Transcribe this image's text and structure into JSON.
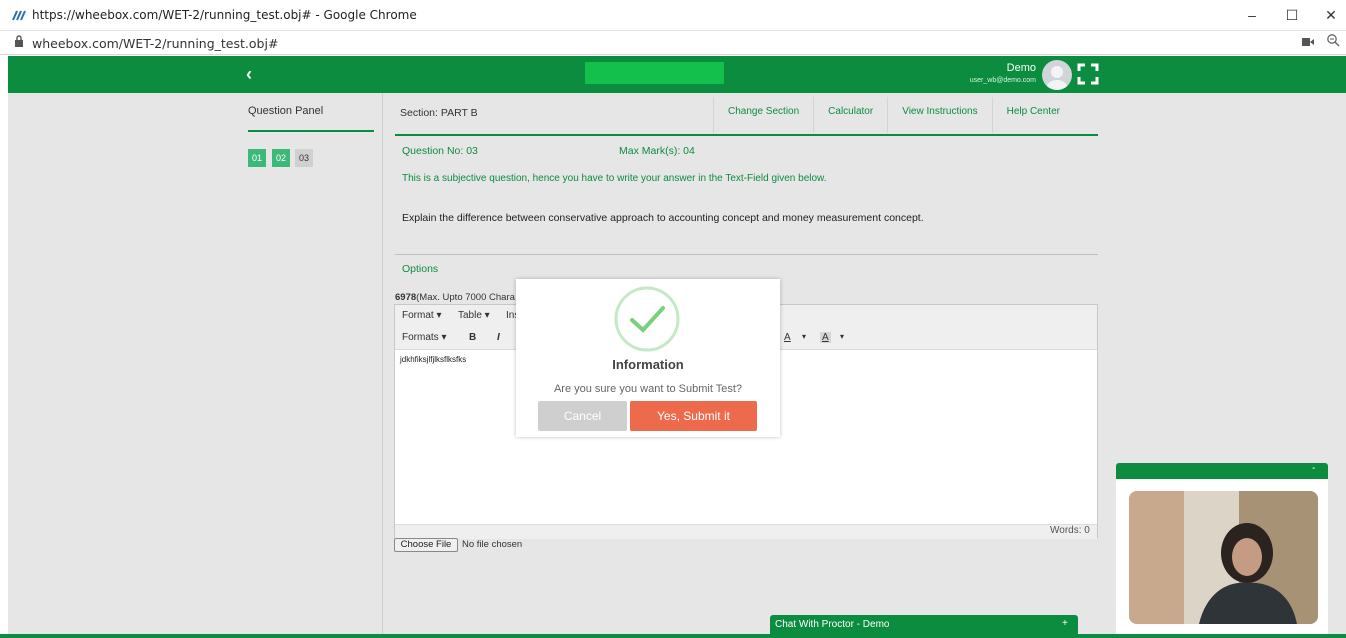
{
  "browser": {
    "title": "https://wheebox.com/WET-2/running_test.obj# - Google Chrome",
    "address": "wheebox.com/WET-2/running_test.obj#",
    "controls": [
      "–",
      "☐",
      "✕"
    ]
  },
  "header": {
    "back_icon": "‹",
    "user_name": "Demo",
    "user_email": "user_wb@demo.com",
    "accent": "#0c8c3f"
  },
  "question_panel": {
    "title": "Question Panel",
    "questions": [
      "01",
      "02",
      "03"
    ]
  },
  "section": {
    "label": "Section: PART B",
    "tabs": [
      "Change Section",
      "Calculator",
      "View Instructions",
      "Help Center"
    ]
  },
  "question": {
    "number": "Question No: 03",
    "max_marks": "Max Mark(s): 04",
    "note": "This is a subjective question, hence you have to write your answer in the Text-Field given below.",
    "text": "Explain the difference between conservative approach to accounting concept and money measurement concept.",
    "options_label": "Options",
    "char_count": "6978",
    "char_limit": "(Max. Upto 7000 Chara"
  },
  "editor": {
    "toolbar1": [
      "Format ▾",
      "Table ▾",
      "Ins"
    ],
    "toolbar2": [
      "Formats ▾",
      "B",
      "I"
    ],
    "toolbar2_right": [
      "A",
      "▾",
      "A",
      "▾"
    ],
    "content": "jdkhfiksjlfjlksflksfks",
    "words": "Words: 0"
  },
  "file": {
    "button": "Choose File",
    "status": "No file chosen"
  },
  "chat": {
    "label": "Chat With Proctor - Demo",
    "toggle": "+"
  },
  "camera": {
    "toggle": "-"
  },
  "modal": {
    "title": "Information",
    "message": "Are you sure you want to Submit Test?",
    "cancel": "Cancel",
    "confirm": "Yes, Submit it",
    "confirm_color": "#ee6a4c",
    "icon": "check-icon"
  }
}
